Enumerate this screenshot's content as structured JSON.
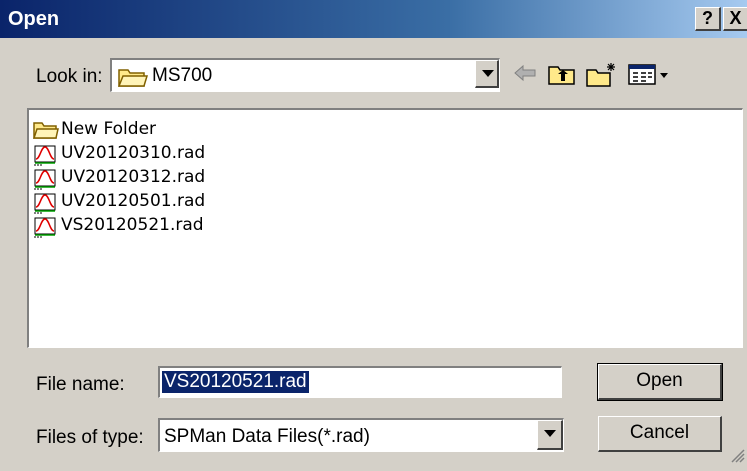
{
  "window": {
    "title": "Open",
    "help_label": "?",
    "close_label": "X"
  },
  "lookin": {
    "label": "Look in:",
    "value": "MS700",
    "icons": [
      "folder-icon",
      "back-arrow-icon",
      "up-folder-icon",
      "new-folder-icon",
      "view-menu-icon"
    ]
  },
  "files": [
    {
      "name": "New Folder",
      "icon": "folder-icon"
    },
    {
      "name": "UV20120310.rad",
      "icon": "spectrum-file-icon"
    },
    {
      "name": "UV20120312.rad",
      "icon": "spectrum-file-icon"
    },
    {
      "name": "UV20120501.rad",
      "icon": "spectrum-file-icon"
    },
    {
      "name": "VS20120521.rad",
      "icon": "spectrum-file-icon"
    }
  ],
  "filename": {
    "label": "File name:",
    "value": "VS20120521.rad"
  },
  "filetype": {
    "label": "Files of type:",
    "value": "SPMan Data Files(*.rad)"
  },
  "buttons": {
    "open": "Open",
    "cancel": "Cancel"
  },
  "colors": {
    "title_bar": "#0a246a",
    "face": "#d4d0c8",
    "selection": "#0a246a"
  }
}
